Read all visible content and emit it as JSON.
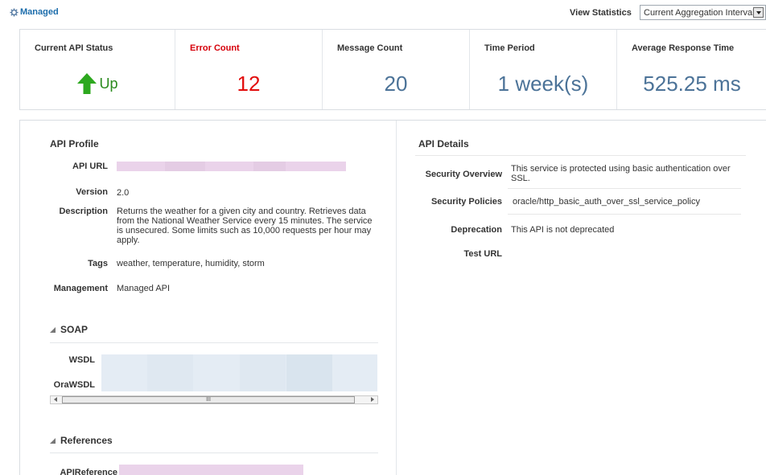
{
  "topbar": {
    "managed_label": "Managed",
    "view_statistics_label": "View Statistics",
    "aggregation_value": "Current Aggregation Interval"
  },
  "stats": {
    "api_status_label": "Current API Status",
    "api_status_value": "Up",
    "error_count_label": "Error Count",
    "error_count_value": "12",
    "message_count_label": "Message Count",
    "message_count_value": "20",
    "time_period_label": "Time Period",
    "time_period_value": "1 week(s)",
    "avg_response_label": "Average Response Time",
    "avg_response_value": "525.25 ms"
  },
  "profile": {
    "title": "API Profile",
    "url_label": "API URL",
    "version_label": "Version",
    "version_value": "2.0",
    "description_label": "Description",
    "description_value": "Returns the weather for a given city and country. Retrieves data from the National Weather Service every 15 minutes. The service is unsecured. Some limits such as 10,000 requests per hour may apply.",
    "tags_label": "Tags",
    "tags_value": "weather, temperature, humidity, storm",
    "management_label": "Management",
    "management_value": "Managed API"
  },
  "soap": {
    "title": "SOAP",
    "wsdl_label": "WSDL",
    "orawsdl_label": "OraWSDL",
    "scroll_thumb_glyph": "III"
  },
  "references": {
    "title": "References",
    "api_reference_label": "APIReference"
  },
  "details": {
    "title": "API Details",
    "security_overview_label": "Security Overview",
    "security_overview_value": "This service is protected using basic authentication over SSL.",
    "security_policies_label": "Security Policies",
    "security_policies_value": "oracle/http_basic_auth_over_ssl_service_policy",
    "deprecation_label": "Deprecation",
    "deprecation_value": "This API is not deprecated",
    "test_url_label": "Test URL"
  },
  "colors": {
    "link": "#1b6cab",
    "error": "#e20d0d",
    "metric": "#4c7398",
    "status_up": "#2a8a1d",
    "redacted_url": "#ead3ea",
    "table_fill": "#e4ecf4"
  }
}
